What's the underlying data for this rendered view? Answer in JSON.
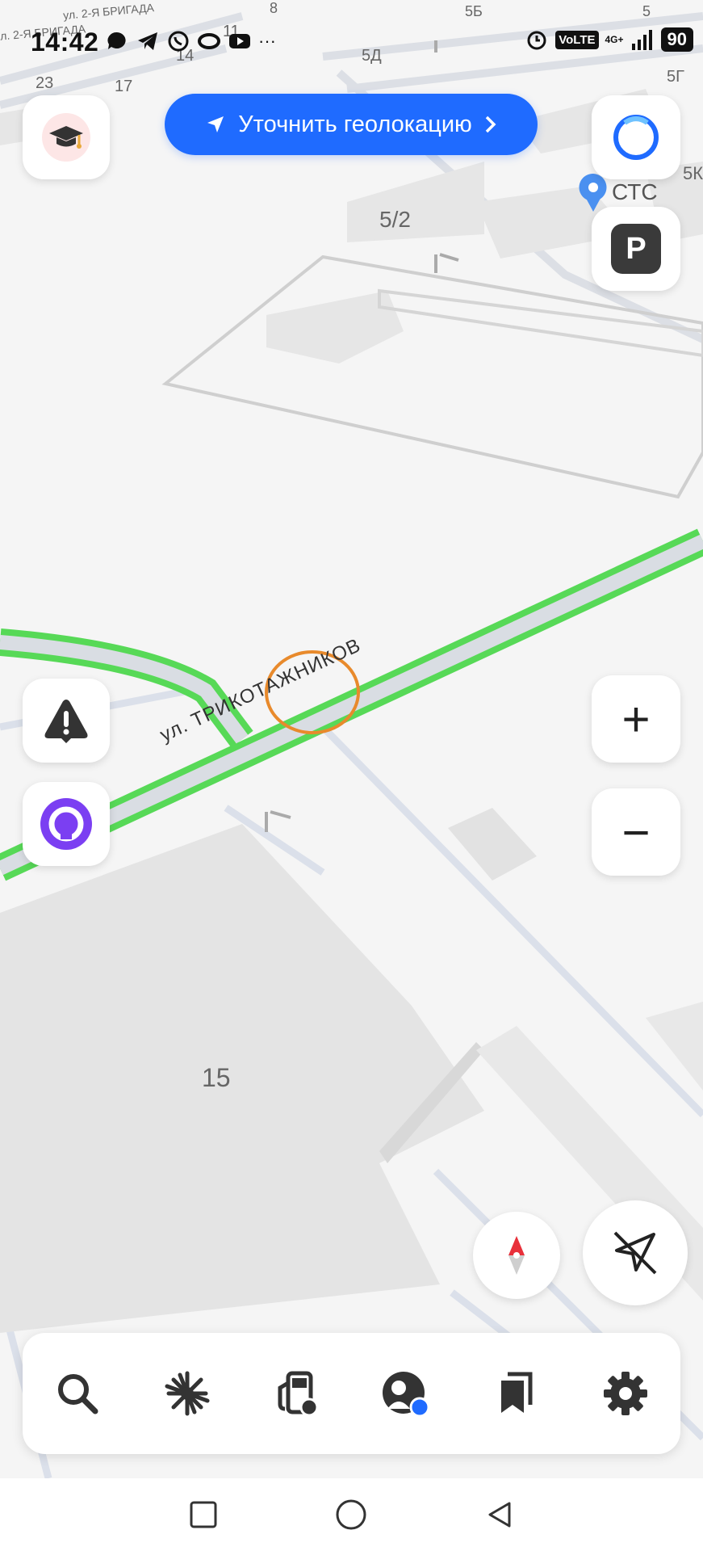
{
  "status_bar": {
    "time": "14:42",
    "battery": "90",
    "volte": "VoLTE",
    "network": "4G+"
  },
  "geo_button": {
    "label": "Уточнить геолокацию"
  },
  "map": {
    "street_name": "ул. ТРИКОТАЖНИКОВ",
    "street_top": "ул. 2-Я БРИГАДА",
    "street_top_left": "л. 2-Я БРИГАДА",
    "poi_name": "СТС",
    "parking_label": "P",
    "building_labels": {
      "b8": "8",
      "b5b": "5Б",
      "b5": "5",
      "b11": "11",
      "b14": "14",
      "b23": "23",
      "b17": "17",
      "b5d": "5Д",
      "b5g": "5Г",
      "b5k": "5К",
      "b52": "5/2",
      "b15": "15"
    }
  },
  "controls": {
    "zoom_in": "+",
    "zoom_out": "−"
  },
  "bottom_tabs": [
    {
      "name": "search",
      "icon": "search-icon"
    },
    {
      "name": "discover",
      "icon": "sparkle-icon"
    },
    {
      "name": "refuel",
      "icon": "fuel-icon"
    },
    {
      "name": "profile",
      "icon": "profile-icon"
    },
    {
      "name": "bookmarks",
      "icon": "bookmarks-icon"
    },
    {
      "name": "settings",
      "icon": "gear-icon"
    }
  ],
  "colors": {
    "accent": "#1f6bff",
    "road_traffic": "#4cd94c",
    "alice": "#7b3ff2",
    "compass_red": "#e8303a"
  }
}
